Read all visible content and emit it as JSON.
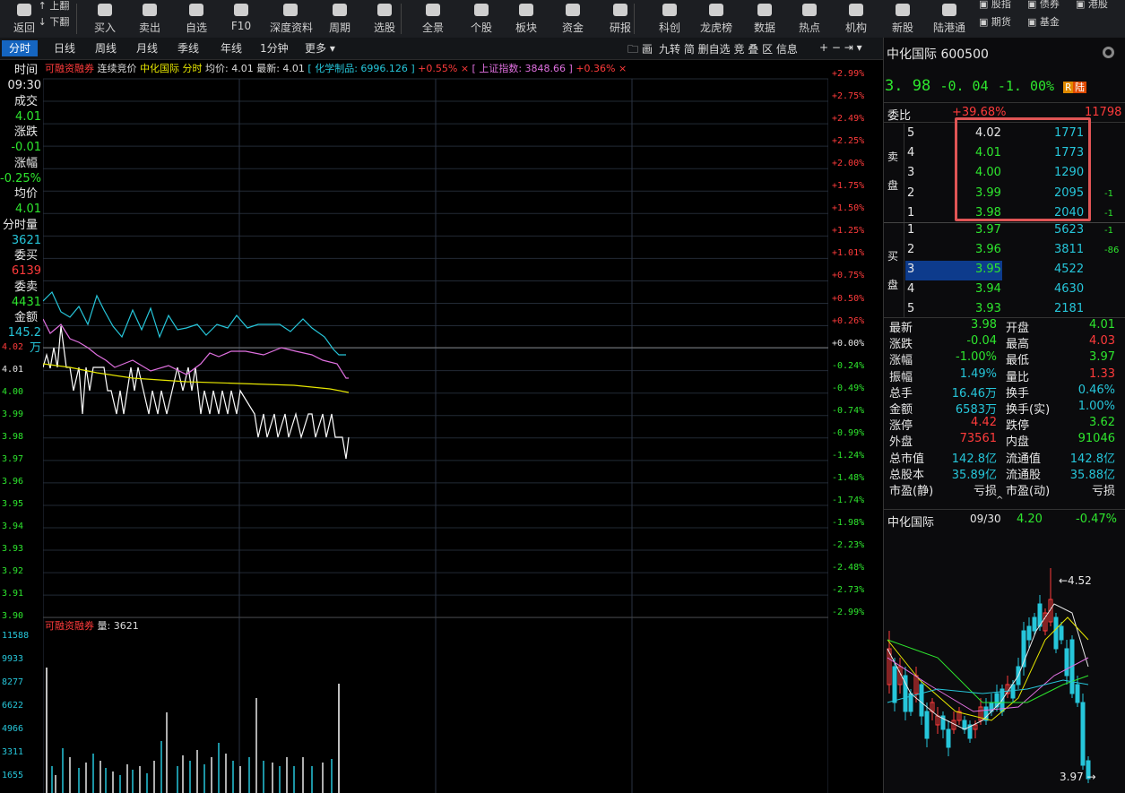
{
  "toolbar": {
    "items": [
      {
        "label": "返回",
        "icon": "arrow-left-icon"
      },
      {
        "label": "买入",
        "icon": "buy-icon"
      },
      {
        "label": "卖出",
        "icon": "sell-icon"
      },
      {
        "label": "自选",
        "icon": "star-icon"
      },
      {
        "label": "F10",
        "icon": "f10-icon"
      },
      {
        "label": "深度资料",
        "icon": "document-icon"
      },
      {
        "label": "周期",
        "icon": "clock-icon"
      },
      {
        "label": "选股",
        "icon": "filter-icon"
      },
      {
        "label": "全景",
        "icon": "grid-icon"
      },
      {
        "label": "个股",
        "icon": "candle-icon"
      },
      {
        "label": "板块",
        "icon": "layers-icon"
      },
      {
        "label": "资金",
        "icon": "yen-icon"
      },
      {
        "label": "研报",
        "icon": "report-icon"
      },
      {
        "label": "科创",
        "icon": "innovation-icon"
      },
      {
        "label": "龙虎榜",
        "icon": "bar-chart-icon"
      },
      {
        "label": "数据",
        "icon": "trend-icon"
      },
      {
        "label": "热点",
        "icon": "fire-icon"
      },
      {
        "label": "机构",
        "icon": "building-icon"
      },
      {
        "label": "新股",
        "icon": "ipo-icon"
      },
      {
        "label": "陆港通",
        "icon": "hk-connect-icon"
      }
    ],
    "pageup": "上翻",
    "pagedown": "下翻",
    "markets": [
      "股指",
      "债券",
      "港股",
      "期货",
      "基金"
    ]
  },
  "tabs": [
    "分时",
    "日线",
    "周线",
    "月线",
    "季线",
    "年线",
    "1分钟",
    "更多 ▾"
  ],
  "tools": "九转  简  删自选  竞  叠  区  信息",
  "tools_prefix": "画",
  "header": {
    "margin": "可融资融券",
    "auction": "连续竞价",
    "name": "中化国际",
    "mode": "分时",
    "avg_label": "均价:",
    "avg": "4.01",
    "last_label": "最新:",
    "last": "4.01",
    "idx1_name": "化学制品:",
    "idx1_val": "6996.126",
    "idx1_chg": "+0.55%",
    "idx2_name": "上证指数:",
    "idx2_val": "3848.66",
    "idx2_chg": "+0.36%"
  },
  "left_panel": [
    {
      "label": "时间",
      "value": "09:30",
      "cls": "white"
    },
    {
      "label": "成交",
      "value": "4.01",
      "cls": "green"
    },
    {
      "label": "涨跌",
      "value": "-0.01",
      "cls": "green"
    },
    {
      "label": "涨幅",
      "value": "-0.25%",
      "cls": "green"
    },
    {
      "label": "均价",
      "value": "4.01",
      "cls": "green"
    },
    {
      "label": "分时量",
      "value": "3621",
      "cls": "cyan"
    },
    {
      "label": "委买",
      "value": "6139",
      "cls": "red"
    },
    {
      "label": "委卖",
      "value": "4431",
      "cls": "green"
    },
    {
      "label": "金额",
      "value": "145.2万",
      "cls": "cyan"
    }
  ],
  "price_axis": [
    "4.02",
    "4.01",
    "4.00",
    "3.99",
    "3.98",
    "3.97",
    "3.96",
    "3.95",
    "3.94",
    "3.93",
    "3.92",
    "3.91",
    "3.90"
  ],
  "pct_axis": [
    "+2.99%",
    "+2.75%",
    "+2.49%",
    "+2.25%",
    "+2.00%",
    "+1.75%",
    "+1.50%",
    "+1.25%",
    "+1.01%",
    "+0.75%",
    "+0.50%",
    "+0.26%",
    "+0.00%",
    "-0.24%",
    "-0.49%",
    "-0.74%",
    "-0.99%",
    "-1.24%",
    "-1.48%",
    "-1.74%",
    "-1.98%",
    "-2.23%",
    "-2.48%",
    "-2.73%",
    "-2.99%"
  ],
  "vol_header": {
    "margin": "可融资融券",
    "label": "量:",
    "value": "3621"
  },
  "vol_axis": [
    "11588",
    "9933",
    "8277",
    "6622",
    "4966",
    "3311",
    "1655"
  ],
  "stock": {
    "name": "中化国际",
    "code": "600500",
    "price": "3. 98",
    "chg": "-0. 04",
    "pct": "-1. 00%",
    "badges": [
      "R",
      "陆"
    ]
  },
  "weibi": {
    "label": "委比",
    "pct": "+39.68%",
    "diff": "11798"
  },
  "sell": [
    {
      "lvl": "5",
      "price": "4.02",
      "vol": "1771",
      "extra": ""
    },
    {
      "lvl": "4",
      "price": "4.01",
      "vol": "1773",
      "extra": ""
    },
    {
      "lvl": "3",
      "price": "4.00",
      "vol": "1290",
      "extra": ""
    },
    {
      "lvl": "2",
      "price": "3.99",
      "vol": "2095",
      "extra": "-1"
    },
    {
      "lvl": "1",
      "price": "3.98",
      "vol": "2040",
      "extra": "-1"
    }
  ],
  "sell_label": [
    "卖",
    "盘"
  ],
  "buy": [
    {
      "lvl": "1",
      "price": "3.97",
      "vol": "5623",
      "extra": "-1"
    },
    {
      "lvl": "2",
      "price": "3.96",
      "vol": "3811",
      "extra": "-86"
    },
    {
      "lvl": "3",
      "price": "3.95",
      "vol": "4522",
      "extra": ""
    },
    {
      "lvl": "4",
      "price": "3.94",
      "vol": "4630",
      "extra": ""
    },
    {
      "lvl": "5",
      "price": "3.93",
      "vol": "2181",
      "extra": ""
    }
  ],
  "buy_label": [
    "买",
    "盘"
  ],
  "stats": [
    [
      "最新",
      "3.98",
      "green",
      "开盘",
      "4.01",
      "green"
    ],
    [
      "涨跌",
      "-0.04",
      "green",
      "最高",
      "4.03",
      "red"
    ],
    [
      "涨幅",
      "-1.00%",
      "green",
      "最低",
      "3.97",
      "green"
    ],
    [
      "振幅",
      "1.49%",
      "cyan",
      "量比",
      "1.33",
      "red"
    ],
    [
      "总手",
      "16.46万",
      "cyan",
      "换手",
      "0.46%",
      "cyan"
    ],
    [
      "金额",
      "6583万",
      "cyan",
      "换手(实)",
      "1.00%",
      "cyan"
    ],
    [
      "涨停",
      "4.42",
      "red",
      "跌停",
      "3.62",
      "green"
    ],
    [
      "外盘",
      "73561",
      "red",
      "内盘",
      "91046",
      "green"
    ],
    [
      "总市值",
      "142.8亿",
      "cyan",
      "流通值",
      "142.8亿",
      "cyan"
    ],
    [
      "总股本",
      "35.89亿",
      "cyan",
      "流通股",
      "35.88亿",
      "cyan"
    ],
    [
      "市盈(静)",
      "亏损",
      "white",
      "市盈(动)",
      "亏损",
      "white"
    ]
  ],
  "mini": {
    "name": "中化国际",
    "date": "09/30",
    "price": "4.20",
    "pct": "-0.47%",
    "high": "4.52",
    "low": "3.97"
  }
}
